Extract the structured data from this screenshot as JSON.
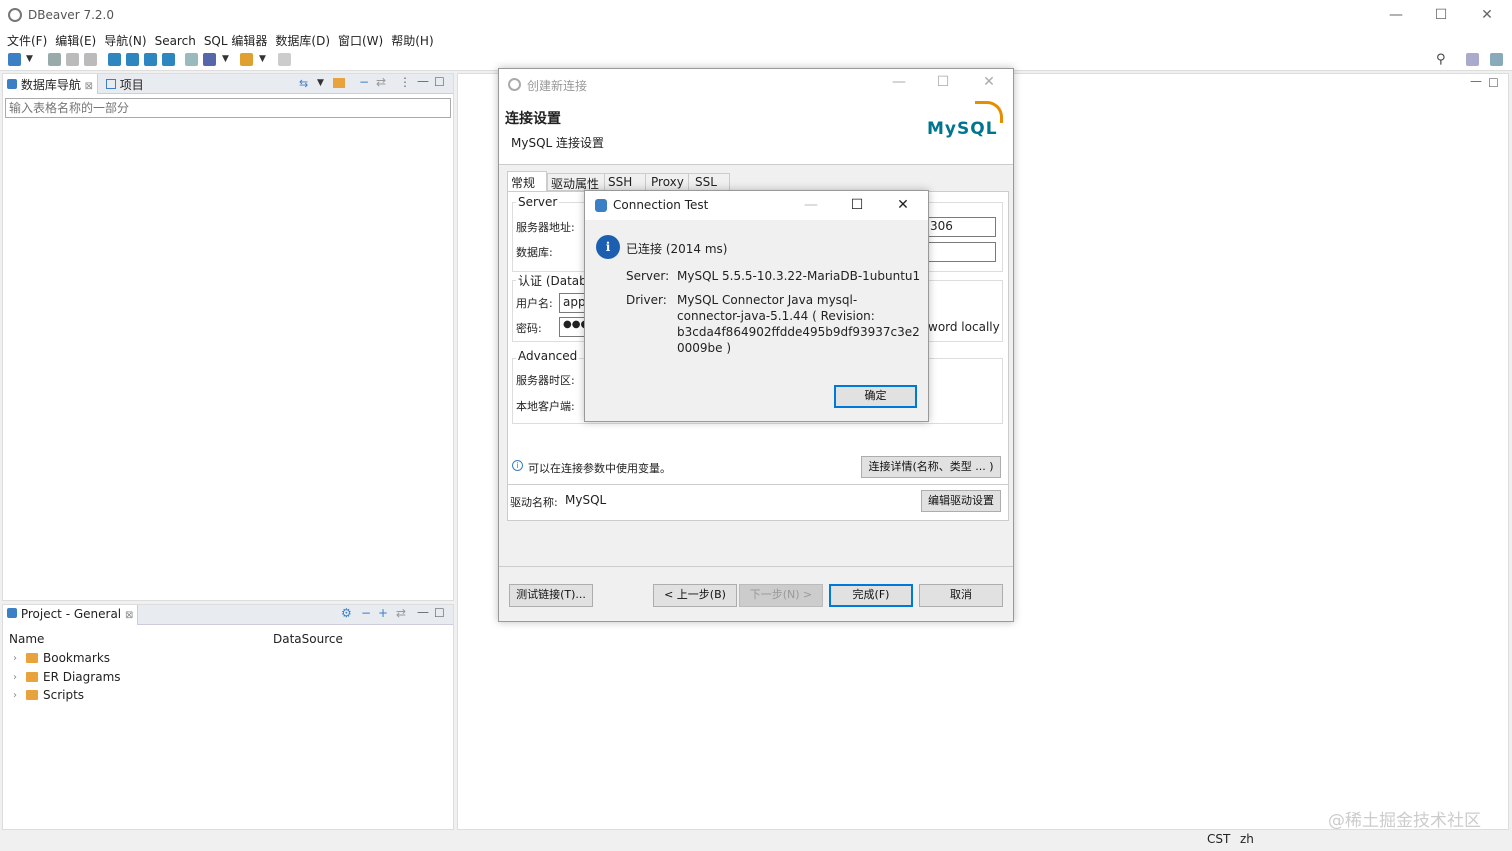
{
  "app": {
    "title": "DBeaver 7.2.0"
  },
  "menu": [
    "文件(F)",
    "编辑(E)",
    "导航(N)",
    "Search",
    "SQL 编辑器",
    "数据库(D)",
    "窗口(W)",
    "帮助(H)"
  ],
  "navigator": {
    "tabs": [
      "数据库导航",
      "项目"
    ],
    "filter_placeholder": "输入表格名称的一部分"
  },
  "project": {
    "tab": "Project - General",
    "columns": [
      "Name",
      "DataSource"
    ],
    "items": [
      "Bookmarks",
      "ER Diagrams",
      "Scripts"
    ]
  },
  "conn_dialog": {
    "title": "创建新连接",
    "heading": "连接设置",
    "subheading": "MySQL 连接设置",
    "logo_text": "MySQL",
    "tabs": [
      "常规",
      "驱动属性",
      "SSH",
      "Proxy",
      "SSL"
    ],
    "server_group": "Server",
    "host_label": "服务器地址:",
    "db_label": "数据库:",
    "port_partial": "306",
    "auth_group": "认证 (Databa",
    "user_label": "用户名:",
    "user_value": "app",
    "password_label": "密码:",
    "password_value": "●●●",
    "save_partial": "word locally",
    "advanced_group": "Advanced",
    "timezone_label": "服务器时区:",
    "client_label": "本地客户端:",
    "info_text": "可以在连接参数中使用变量。",
    "details_button": "连接详情(名称、类型 ... )",
    "driver_label": "驱动名称:",
    "driver_value": "MySQL",
    "edit_driver_button": "编辑驱动设置",
    "test_button": "测试链接(T)...",
    "back_button": "< 上一步(B)",
    "next_button": "下一步(N) >",
    "finish_button": "完成(F)",
    "cancel_button": "取消"
  },
  "test_dialog": {
    "title": "Connection Test",
    "status": "已连接 (2014 ms)",
    "server_label": "Server:",
    "server_value": "MySQL 5.5.5-10.3.22-MariaDB-1ubuntu1",
    "driver_label": "Driver:",
    "driver_lines": [
      "MySQL Connector Java mysql-",
      "connector-java-5.1.44 ( Revision:",
      "b3cda4f864902ffdde495b9df93937c3e2",
      "0009be )"
    ],
    "ok_button": "确定"
  },
  "statusbar": {
    "tz": "CST",
    "lang": "zh"
  },
  "watermark": "@稀土掘金技术社区"
}
